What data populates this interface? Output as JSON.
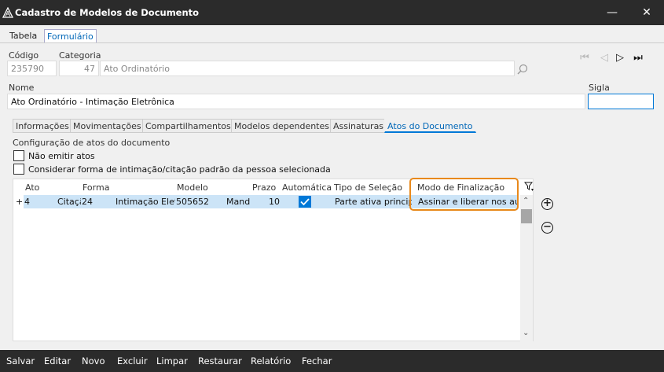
{
  "window": {
    "title": "Cadastro de Modelos de Documento",
    "minimize_icon": "minimize-icon",
    "close_icon": "close-icon"
  },
  "tabs": [
    {
      "label": "Tabela"
    },
    {
      "label": "Formulário"
    }
  ],
  "form": {
    "codigo_label": "Código",
    "codigo_value": "235790",
    "categoria_label": "Categoria",
    "categoria_code": "47",
    "categoria_name": "Ato Ordinatório",
    "nome_label": "Nome",
    "nome_value": "Ato Ordinatório - Intimação Eletrônica",
    "sigla_label": "Sigla",
    "sigla_value": ""
  },
  "subtabs": [
    {
      "label": "Informações"
    },
    {
      "label": "Movimentações"
    },
    {
      "label": "Compartilhamentos"
    },
    {
      "label": "Modelos dependentes"
    },
    {
      "label": "Assinaturas"
    },
    {
      "label": "Atos do Documento"
    }
  ],
  "atos": {
    "section_title": "Configuração de atos do documento",
    "check_nao_emitir": "Não emitir atos",
    "check_considerar": "Considerar forma de intimação/citação padrão da pessoa selecionada",
    "columns": [
      "Ato",
      "Forma",
      "Modelo",
      "Prazo",
      "Automática",
      "Tipo de Seleção",
      "Modo de Finalização"
    ],
    "rows": [
      {
        "expand": "+",
        "ato": "4",
        "forma_text": "Citaçã",
        "forma_code": "24",
        "modelo_text": "Intimação Eletr",
        "modelo_code": "505652",
        "modelo_extra": "Mandí",
        "prazo": "10",
        "automatica": true,
        "tipo_selecao": "Parte ativa principal",
        "modo_finalizacao": "Assinar e liberar nos autos"
      }
    ]
  },
  "bottom_buttons": [
    {
      "label": "Salvar"
    },
    {
      "label": "Editar"
    },
    {
      "label": "Novo"
    },
    {
      "label": "Excluir"
    },
    {
      "label": "Limpar"
    },
    {
      "label": "Restaurar"
    },
    {
      "label": "Relatório"
    },
    {
      "label": "Fechar"
    }
  ],
  "colors": {
    "titlebar": "#2b2b2b",
    "accent": "#0078d7",
    "highlight": "#e8891c",
    "row_selected": "#cce4f7"
  }
}
